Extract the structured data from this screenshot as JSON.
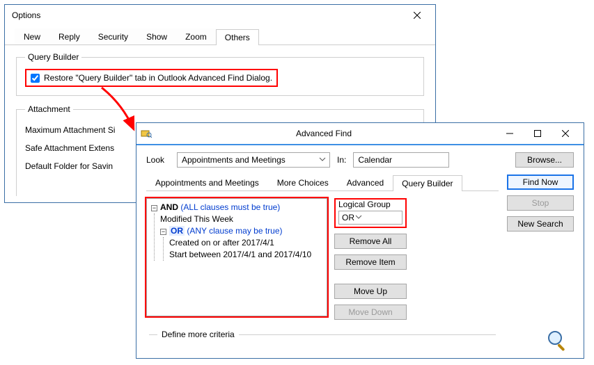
{
  "options": {
    "title": "Options",
    "tabs": [
      "New",
      "Reply",
      "Security",
      "Show",
      "Zoom",
      "Others"
    ],
    "activeTab": 5,
    "queryBuilder": {
      "legend": "Query Builder",
      "checkbox_label": "Restore \"Query Builder\" tab in Outlook Advanced Find Dialog.",
      "checked": true
    },
    "attachment": {
      "legend": "Attachment",
      "rows": [
        "Maximum Attachment Si",
        "Safe Attachment Extens",
        "Default Folder for Savin"
      ]
    }
  },
  "advFind": {
    "title": "Advanced Find",
    "look_label": "Look",
    "look_value": "Appointments and Meetings",
    "in_label": "In:",
    "in_value": "Calendar",
    "browse_btn": "Browse...",
    "tabs": [
      "Appointments and Meetings",
      "More Choices",
      "Advanced",
      "Query Builder"
    ],
    "activeTab": 3,
    "right_buttons": {
      "find_now": "Find Now",
      "stop": "Stop",
      "new_search": "New Search"
    },
    "tree": {
      "and_label": "AND",
      "and_hint": "(ALL clauses must be true)",
      "modified": "Modified This Week",
      "or_label": "OR",
      "or_hint": "(ANY clause may be true)",
      "c1": "Created on or after 2017/4/1",
      "c2": "Start between 2017/4/1 and 2017/4/10"
    },
    "logical_group": {
      "label": "Logical Group",
      "value": "OR"
    },
    "mid_buttons": {
      "remove_all": "Remove All",
      "remove_item": "Remove Item",
      "move_up": "Move Up",
      "move_down": "Move Down"
    },
    "define_legend": "Define more criteria"
  }
}
